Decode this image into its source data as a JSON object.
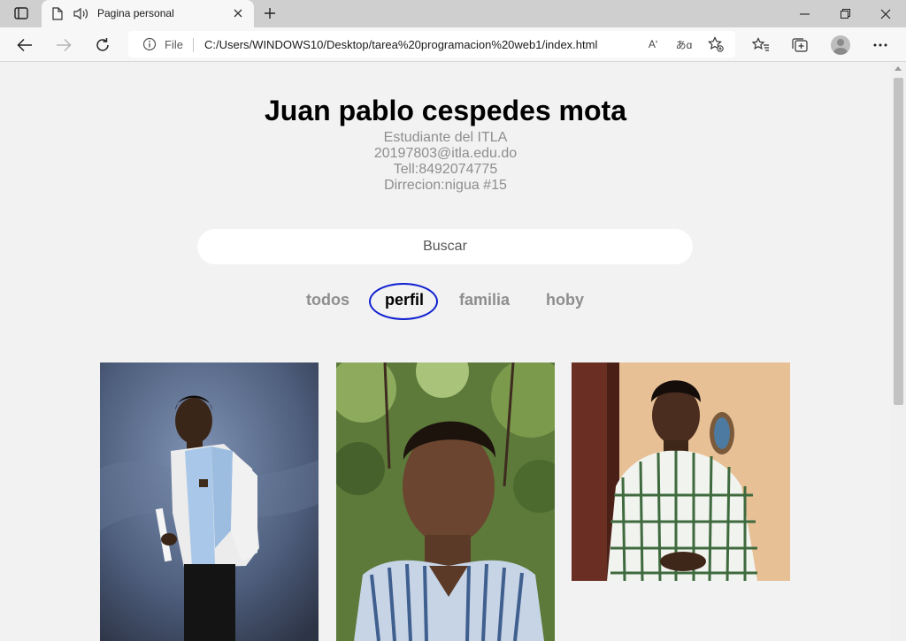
{
  "browser": {
    "tab_title": "Pagina personal",
    "address_scheme_label": "File",
    "url": "C:/Users/WINDOWS10/Desktop/tarea%20programacion%20web1/index.html",
    "read_aloud_label": "Aʹ",
    "translate_label": "あɑ"
  },
  "icons": {
    "tab_actions": "tab-actions-icon",
    "page": "page-icon",
    "audio": "speaker-icon",
    "close_tab": "close-icon",
    "new_tab": "plus-icon",
    "minimize": "minimize-icon",
    "restore": "restore-icon",
    "close_window": "close-icon",
    "back": "back-arrow-icon",
    "forward": "forward-arrow-icon",
    "refresh": "refresh-icon",
    "info": "info-icon",
    "favorite": "star-add-icon",
    "favorites": "favorites-icon",
    "collections": "collections-icon",
    "profile": "profile-icon",
    "menu": "more-icon"
  },
  "profile": {
    "name": "Juan pablo cespedes mota",
    "lines": [
      "Estudiante del ITLA",
      "20197803@itla.edu.do",
      "Tell:8492074775",
      "Dirrecion:nigua #15"
    ]
  },
  "search": {
    "placeholder": "Buscar"
  },
  "filters": [
    "todos",
    "perfil",
    "familia",
    "hoby"
  ],
  "active_filter": "perfil",
  "colors": {
    "page_background": "#f2f2f2",
    "muted_text": "#8e8e8e",
    "highlight_circle": "#1020d0"
  }
}
